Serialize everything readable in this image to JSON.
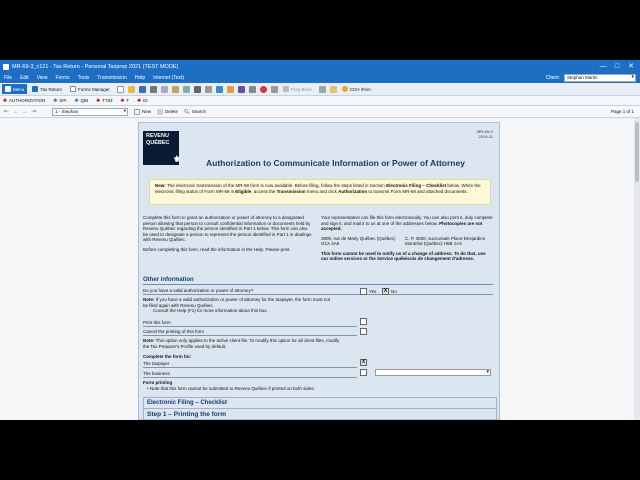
{
  "window": {
    "title": "MR-69-3_c121 - Tax Return - Personal Taxprep 2021 (TEST MODE)",
    "minimize": "—",
    "maximize": "□",
    "close": "✕"
  },
  "menu": [
    "File",
    "Edit",
    "View",
    "Forms",
    "Tools",
    "Transmission",
    "Help",
    "Internet (Test)"
  ],
  "client": {
    "label": "Client:",
    "value": "Stephan Martin"
  },
  "toolbar": {
    "menu_label": "Menu",
    "tax_return": "Tax Return",
    "forms_manager": "Forms Manager",
    "prep_book": "Prep Book",
    "cch_ifirm": "CCH iFirm"
  },
  "form_tabs": [
    "AUTHORIZATION",
    "SPI",
    "QBI",
    "T783",
    "T",
    "ID"
  ],
  "nav": {
    "form_select": "1 - Stephan",
    "new": "New",
    "delete": "Delete",
    "search": "Search",
    "page_info": "Page 1 of 1"
  },
  "form": {
    "logo_line1": "REVENU",
    "logo_line2": "QUÉBEC",
    "form_id": "MR-69-V",
    "form_year": "2019-11",
    "title": "Authorization to Communicate Information or Power of Attorney",
    "notice": {
      "new_label": "New:",
      "text1": "The electronic transmission of the MR-69 form is now available. Before filing, follow the steps listed in Section",
      "bold1": "Electronic Filing – Checklist",
      "text2": "below. When the electronic filing status of Form MR-69 is",
      "bold2": "Eligible",
      "text3": ", access the",
      "bold3": "Transmission",
      "text4": "menu and click",
      "bold4": "Authorization",
      "text5": "to transmit Form MR-69 and attached documents."
    },
    "intro_left_1": "Complete this form to grant an authorization or power of attorney to a designated person allowing that person to consult confidential information or documents held by Revenu Québec regarding the person identified in Part 1 below. This form can also be used to designate a person to represent the person identified in Part 1 in dealings with Revenu Québec.",
    "intro_left_2": "Before completing this form, read the information in the Help. Please print.",
    "intro_right_1": "Your representative can file this form electronically. You can also print it, duly complete and sign it, and mail it to us at one of the addresses below.",
    "intro_right_bold": "Photocopies are not accepted.",
    "addr_left": "3800, rue de Marly Québec (Québec) G1X 4A5",
    "addr_right": "C. P. 3000, succursale Place-Desjardins Montréal (Québec) H5B 1A4",
    "intro_right_2": "This form cannot be used to notify us of a change of address. To do that, use our online services or the Service québécois de changement d'adresse.",
    "other_info_title": "Other information",
    "q_valid": "Do you have a valid authorization or power of attorney?",
    "yes": "Yes",
    "no": "No",
    "note1_label": "Note:",
    "note1": "If you have a valid authorization or power of attorney for the taxpayer, the form must not be filed again with Revenu Québec.",
    "note1b": "Consult the Help (F1) for more information about this box.",
    "print_form": "Print this form",
    "cancel_print": "Cancel the printing of this form",
    "note2_label": "Note:",
    "note2": "This option only applies to the active client file. To modify this option for all client files, modify the Tax Preparer's Profile used by default.",
    "complete_for": "Complete the form for:",
    "taxpayer": "The taxpayer",
    "business": "The business",
    "form_printing": "Form printing",
    "form_printing_note": "Note that this form cannot be submitted to Revenu Québec if printed on both sides.",
    "checklist_title": "Electronic Filing – Checklist",
    "step1": "Step 1 – Printing the form"
  },
  "colors": {
    "accent": "#1e6fc3",
    "form_bg": "#dbe6f1",
    "notice_bg": "#fdf9d8",
    "heading": "#1b3a6b"
  }
}
